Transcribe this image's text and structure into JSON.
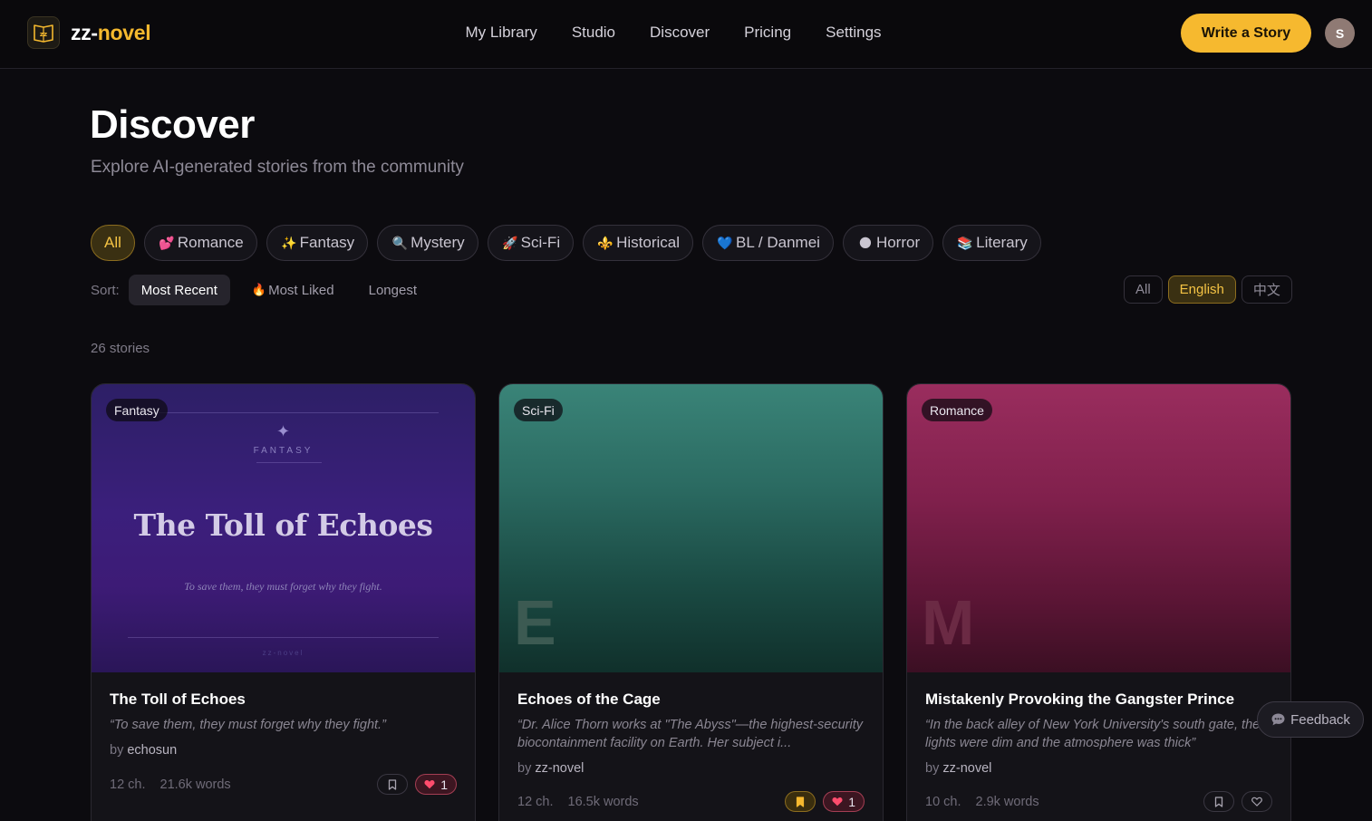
{
  "brand": {
    "name_part1": "zz-",
    "name_part2": "novel",
    "logo_text": "zz"
  },
  "nav": {
    "links": [
      "My Library",
      "Studio",
      "Discover",
      "Pricing",
      "Settings"
    ]
  },
  "write_button": "Write a Story",
  "avatar_initial": "S",
  "header": {
    "title": "Discover",
    "subtitle": "Explore AI-generated stories from the community"
  },
  "genres": [
    {
      "label": "All",
      "icon": "",
      "active": true
    },
    {
      "label": "Romance",
      "icon": "💕"
    },
    {
      "label": "Fantasy",
      "icon": "✨"
    },
    {
      "label": "Mystery",
      "icon": "🔍"
    },
    {
      "label": "Sci-Fi",
      "icon": "🚀"
    },
    {
      "label": "Historical",
      "icon": "⚜️"
    },
    {
      "label": "BL / Danmei",
      "icon": "💙"
    },
    {
      "label": "Horror",
      "icon": "🌑"
    },
    {
      "label": "Literary",
      "icon": "📚"
    }
  ],
  "sort": {
    "label": "Sort:",
    "options": [
      {
        "label": "Most Recent",
        "icon": "",
        "active": true
      },
      {
        "label": "Most Liked",
        "icon": "🔥"
      },
      {
        "label": "Longest",
        "icon": ""
      }
    ]
  },
  "language": {
    "options": [
      "All",
      "English",
      "中文"
    ],
    "active": "English"
  },
  "story_count": "26 stories",
  "cards": [
    {
      "genre": "Fantasy",
      "cover": {
        "kicker": "FANTASY",
        "title": "The Toll of Echoes",
        "tagline": "To save them, they must forget why they fight.",
        "footer": "zz-novel"
      },
      "title": "The Toll of Echoes",
      "description": "“To save them, they must forget why they fight.”",
      "author_prefix": "by",
      "author": "echosun",
      "chapters": "12 ch.",
      "words": "21.6k words",
      "likes": "1",
      "liked": true,
      "saved": false
    },
    {
      "genre": "Sci-Fi",
      "cover": {
        "initial": "E"
      },
      "title": "Echoes of the Cage",
      "description": "“Dr. Alice Thorn works at \"The Abyss\"—the highest-security biocontainment facility on Earth. Her subject i...",
      "author_prefix": "by",
      "author": "zz-novel",
      "chapters": "12 ch.",
      "words": "16.5k words",
      "likes": "1",
      "liked": true,
      "saved": true
    },
    {
      "genre": "Romance",
      "cover": {
        "initial": "M"
      },
      "title": "Mistakenly Provoking the Gangster Prince",
      "description": "“In the back alley of New York University's south gate, the lights were dim and the atmosphere was thick”",
      "author_prefix": "by",
      "author": "zz-novel",
      "chapters": "10 ch.",
      "words": "2.9k words",
      "likes": "",
      "liked": false,
      "saved": false
    }
  ],
  "feedback_label": "Feedback",
  "colors": {
    "accent": "#f6b92f",
    "background": "#0c0b0f",
    "like": "#ff4d6d"
  }
}
